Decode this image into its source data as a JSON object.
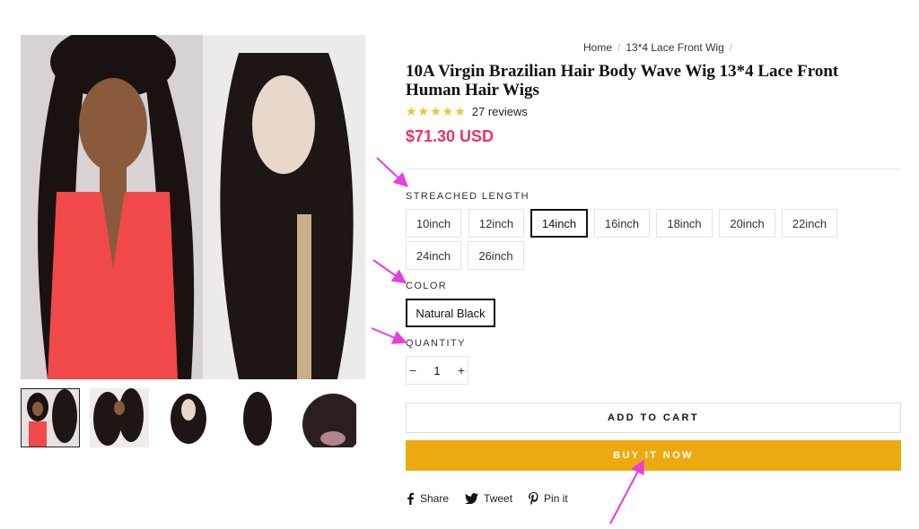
{
  "breadcrumb": {
    "home": "Home",
    "current": "13*4 Lace Front Wig",
    "separator": "/"
  },
  "product": {
    "title": "10A Virgin Brazilian Hair Body Wave Wig 13*4 Lace Front Human Hair Wigs",
    "stars": "★★★★★",
    "reviews": "27 reviews",
    "price": "$71.30 USD"
  },
  "options": {
    "length_label": "STREACHED LENGTH",
    "lengths": [
      "10inch",
      "12inch",
      "14inch",
      "16inch",
      "18inch",
      "20inch",
      "22inch",
      "24inch",
      "26inch"
    ],
    "selected_length": "14inch",
    "color_label": "COLOR",
    "colors": [
      "Natural Black"
    ],
    "selected_color": "Natural Black",
    "quantity_label": "QUANTITY",
    "quantity": "1",
    "minus": "−",
    "plus": "+"
  },
  "actions": {
    "add_to_cart": "ADD TO CART",
    "buy_now": "BUY IT NOW"
  },
  "share": {
    "share": "Share",
    "tweet": "Tweet",
    "pin": "Pin it"
  },
  "colors": {
    "price": "#e8336a",
    "buy_button": "#eda910",
    "annotation_arrow": "#e83de0",
    "stars": "#f1c232"
  },
  "gallery": {
    "thumbnail_count": 5,
    "selected_thumbnail": 1
  }
}
